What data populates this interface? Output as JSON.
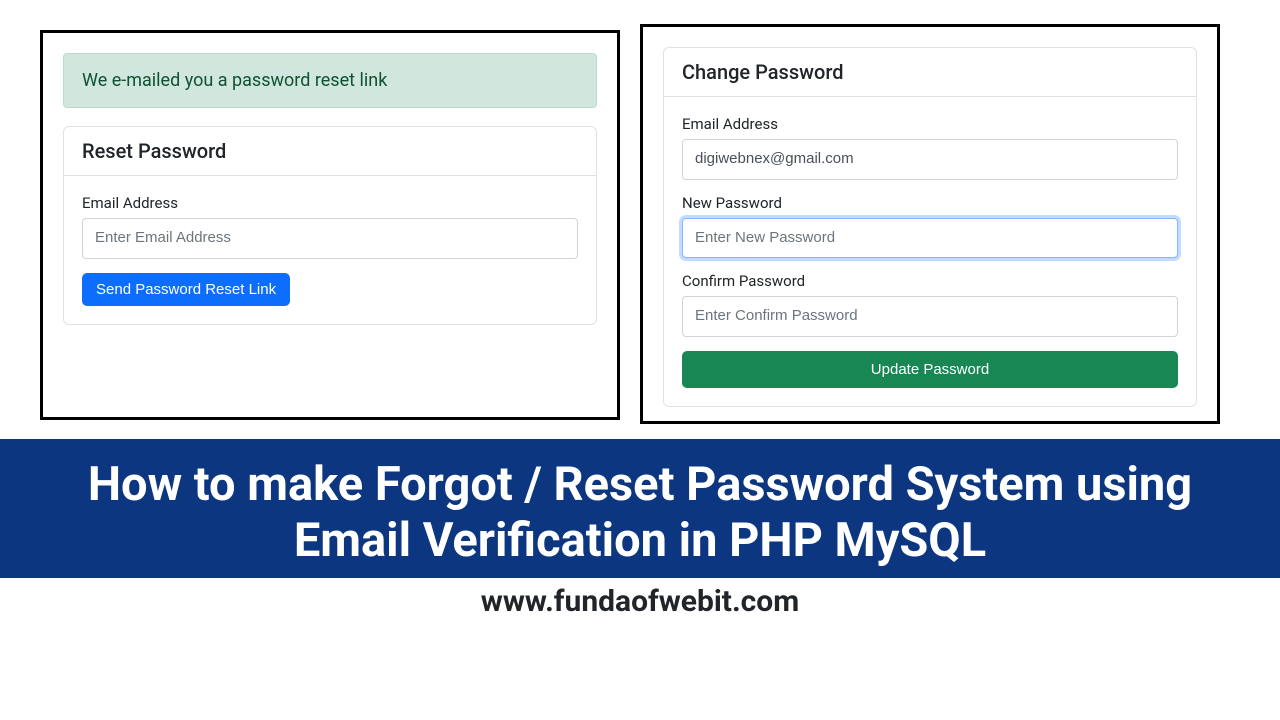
{
  "left": {
    "alert": "We e-mailed you a password reset link",
    "card_title": "Reset Password",
    "email_label": "Email Address",
    "email_placeholder": "Enter Email Address",
    "submit_label": "Send Password Reset Link"
  },
  "right": {
    "card_title": "Change Password",
    "email_label": "Email Address",
    "email_value": "digiwebnex@gmail.com",
    "newpw_label": "New Password",
    "newpw_placeholder": "Enter New Password",
    "confirm_label": "Confirm Password",
    "confirm_placeholder": "Enter Confirm Password",
    "submit_label": "Update Password"
  },
  "banner": {
    "title": "How to make Forgot / Reset Password System using Email Verification in PHP MySQL"
  },
  "footer": {
    "url": "www.fundaofwebit.com"
  }
}
